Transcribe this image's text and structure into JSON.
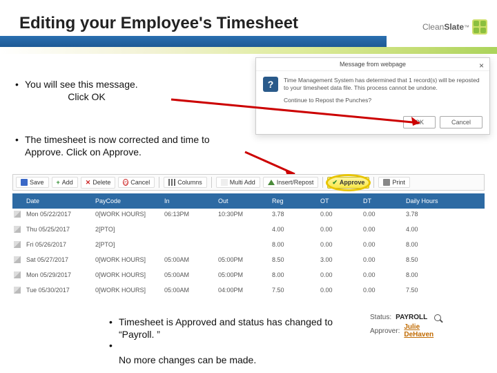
{
  "header": {
    "title": "Editing your Employee's Timesheet",
    "brand1": "Clean",
    "brand2": "Slate"
  },
  "bullets": {
    "b1a": "You will see this message.",
    "b1b": "Click OK",
    "b2": "The timesheet is now corrected and time to Approve.  Click on Approve.",
    "b3a": "Timesheet is Approved and status has changed to “Payroll. ”",
    "b3b": "No more changes can be made."
  },
  "dialog": {
    "title": "Message from webpage",
    "line1": "Time Management System has determined that 1 record(s) will be reposted to your timesheet data file. This process cannot be undone.",
    "line2": "Continue to Repost the Punches?",
    "ok": "OK",
    "cancel": "Cancel"
  },
  "toolbar": {
    "save": "Save",
    "add": "Add",
    "delete": "Delete",
    "cancel": "Cancel",
    "columns": "Columns",
    "multiadd": "Multi Add",
    "insert": "Insert/Repost",
    "approve": "Approve",
    "print": "Print"
  },
  "table": {
    "cols": [
      "",
      "Date",
      "PayCode",
      "In",
      "Out",
      "Reg",
      "OT",
      "DT",
      "Daily Hours"
    ],
    "rows": [
      {
        "date": "Mon 05/22/2017",
        "pc": "0[WORK HOURS]",
        "in": "06:13PM",
        "out": "10:30PM",
        "reg": "3.78",
        "ot": "0.00",
        "dt": "0.00",
        "dh": "3.78"
      },
      {
        "date": "Thu 05/25/2017",
        "pc": "2[PTO]",
        "in": "",
        "out": "",
        "reg": "4.00",
        "ot": "0.00",
        "dt": "0.00",
        "dh": "4.00"
      },
      {
        "date": "Fri 05/26/2017",
        "pc": "2[PTO]",
        "in": "",
        "out": "",
        "reg": "8.00",
        "ot": "0.00",
        "dt": "0.00",
        "dh": "8.00"
      },
      {
        "date": "Sat 05/27/2017",
        "pc": "0[WORK HOURS]",
        "in": "05:00AM",
        "out": "05:00PM",
        "reg": "8.50",
        "ot": "3.00",
        "dt": "0.00",
        "dh": "8.50"
      },
      {
        "date": "Mon 05/29/2017",
        "pc": "0[WORK HOURS]",
        "in": "05:00AM",
        "out": "05:00PM",
        "reg": "8.00",
        "ot": "0.00",
        "dt": "0.00",
        "dh": "8.00"
      },
      {
        "date": "Tue 05/30/2017",
        "pc": "0[WORK HOURS]",
        "in": "05:00AM",
        "out": "04:00PM",
        "reg": "7.50",
        "ot": "0.00",
        "dt": "0.00",
        "dh": "7.50"
      }
    ]
  },
  "status": {
    "status_k": "Status:",
    "status_v": "PAYROLL",
    "approver_k": "Approver:",
    "approver_fn": "Julie",
    "approver_ln": "DeHaven"
  }
}
